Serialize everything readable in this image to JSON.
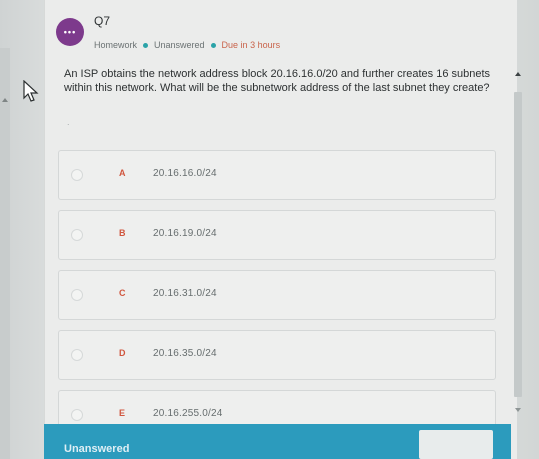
{
  "header": {
    "badge_label": "•••",
    "question_number": "Q7",
    "meta": {
      "type": "Homework",
      "status": "Unanswered",
      "due": "Due in 3 hours"
    }
  },
  "question": {
    "text": "An ISP obtains the network address block 20.16.16.0/20 and further creates 16 subnets within this network. What will be the subnetwork address of the last subnet they create?",
    "hint": "."
  },
  "options": [
    {
      "letter": "A",
      "text": "20.16.16.0/24"
    },
    {
      "letter": "B",
      "text": "20.16.19.0/24"
    },
    {
      "letter": "C",
      "text": "20.16.31.0/24"
    },
    {
      "letter": "D",
      "text": "20.16.35.0/24"
    },
    {
      "letter": "E",
      "text": "20.16.255.0/24"
    }
  ],
  "footer": {
    "status": "Unanswered",
    "submit_label": ""
  },
  "colors": {
    "badge": "#7d3a8c",
    "footer": "#2c9bbd",
    "accent_dot": "#2aa3a8",
    "due": "#c9634b",
    "option_letter": "#d0563e"
  }
}
